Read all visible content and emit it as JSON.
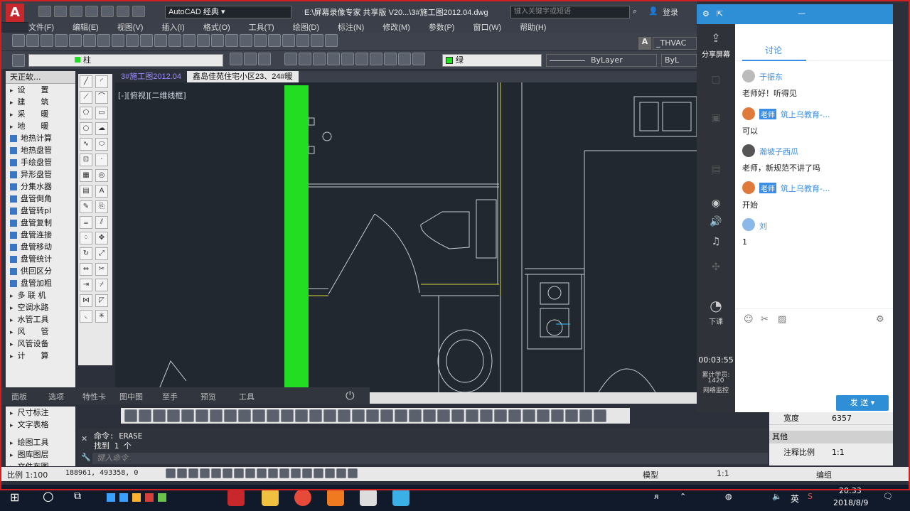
{
  "titlebar": {
    "workspace": "AutoCAD 经典",
    "title": "E:\\屏幕录像专家 共享版 V20...\\3#施工图2012.04.dwg",
    "search_placeholder": "键入关键字或短语",
    "login": "登录"
  },
  "menu": [
    "文件(F)",
    "编辑(E)",
    "视图(V)",
    "插入(I)",
    "格式(O)",
    "工具(T)",
    "绘图(D)",
    "标注(N)",
    "修改(M)",
    "参数(P)",
    "窗口(W)",
    "帮助(H)"
  ],
  "layer": {
    "current": "柱",
    "color": "绿",
    "linetype": "ByLayer",
    "linetype2": "ByL",
    "style": "_THVAC"
  },
  "doc_tabs": [
    "3#施工图2012.04",
    "鑫岛佳苑住宅小区23、24#暖"
  ],
  "viewport_label": "[-][俯视][二维线框]",
  "left_panel": {
    "header": "天正软...",
    "groups": [
      "设　　置",
      "建　　筑",
      "采　　暖",
      "地　　暖"
    ],
    "items": [
      "地热计算",
      "地热盘管",
      "手绘盘管",
      "异形盘管",
      "分集水器",
      "盘管倒角",
      "盘管转pl",
      "盘管复制",
      "盘管连接",
      "盘管移动",
      "盘管统计",
      "供回区分",
      "盘管加粗"
    ],
    "groups2": [
      "多 联 机",
      "空调水路",
      "水管工具",
      "风　　管",
      "风管设备",
      "计　　算"
    ],
    "groups3": [
      "尺寸标注",
      "文字表格",
      "绘图工具",
      "图库图层",
      "文件布图"
    ]
  },
  "panel_tabs": [
    "面板",
    "选项",
    "特性卡",
    "图中图",
    "至手",
    "预览",
    "工具"
  ],
  "command": {
    "line1": "命令:  ERASE",
    "line2": "找到 1 个",
    "prompt": "键入命令"
  },
  "status": {
    "scale": "比例 1:100",
    "coords": "188961, 493358, 0",
    "model": "模型",
    "ratio": "1:1",
    "group": "编组"
  },
  "props": {
    "header_section": "其他",
    "width_label": "宽度",
    "width_value": "6357",
    "scale_label": "注释比例",
    "scale_value": "1:1"
  },
  "sidebar_dark": {
    "share": "分享屏幕",
    "class_end": "下课",
    "timer": "00:03:55",
    "total": "累计学员:",
    "total_num": "1420",
    "network": "网络监控"
  },
  "chat": {
    "tab": "讨论",
    "messages": [
      {
        "name": "于振东",
        "text": "老师好！听得见"
      },
      {
        "badge": "老师",
        "name": "筑上乌教育-...",
        "text": "可以"
      },
      {
        "name": "瀚坡子西瓜",
        "text": "老师，新规范不讲了吗"
      },
      {
        "badge": "老师",
        "name": "筑上乌教育-...",
        "text": "开始"
      },
      {
        "name": "刘",
        "text": "1"
      }
    ],
    "send": "发 送"
  },
  "tray": {
    "ime": "英",
    "time": "20:33",
    "date": "2018/8/9"
  },
  "colors": {
    "accent": "#2e8fd6",
    "green_layer": "#22dd22",
    "cad_bg": "#212830"
  }
}
